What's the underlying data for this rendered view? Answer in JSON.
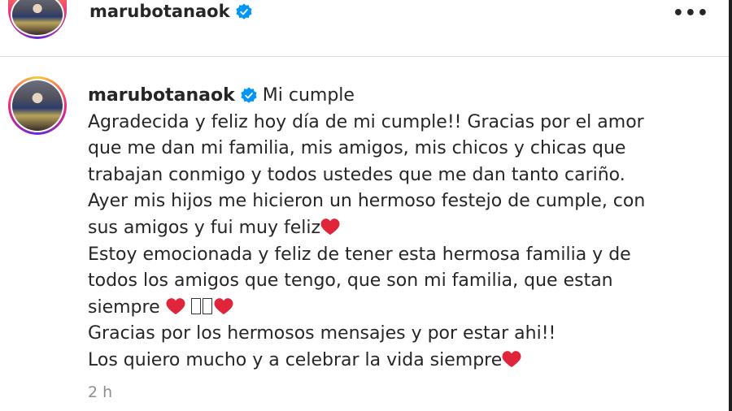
{
  "header": {
    "username": "marubotanaok",
    "more_label": "•••"
  },
  "post": {
    "username": "marubotanaok",
    "title": "Mi cumple",
    "lines": [
      "Agradecida y feliz hoy día de mi cumple!! Gracias por el amor",
      "que me dan mi familia, mis amigos, mis chicos y chicas que",
      "trabajan conmigo y todos ustedes que me dan tanto cariño.",
      "Ayer mis hijos me hicieron un hermoso festejo de cumple, con",
      "sus amigos y fui muy feliz",
      "Estoy emocionada y feliz de tener esta hermosa familia y de",
      "todos los amigos que tengo, que son mi familia, que estan",
      "siempre ",
      "Gracias por los hermosos mensajes y por estar ahi!!",
      "Los quiero mucho y a celebrar la vida siempre"
    ],
    "timestamp": "2 h"
  },
  "colors": {
    "verified": "#0095f6",
    "heart": "#e0243a",
    "muted": "#8e8e8e"
  },
  "icons": {
    "verified": "verified-badge-icon",
    "heart": "red-heart-icon",
    "more": "more-options-icon"
  }
}
